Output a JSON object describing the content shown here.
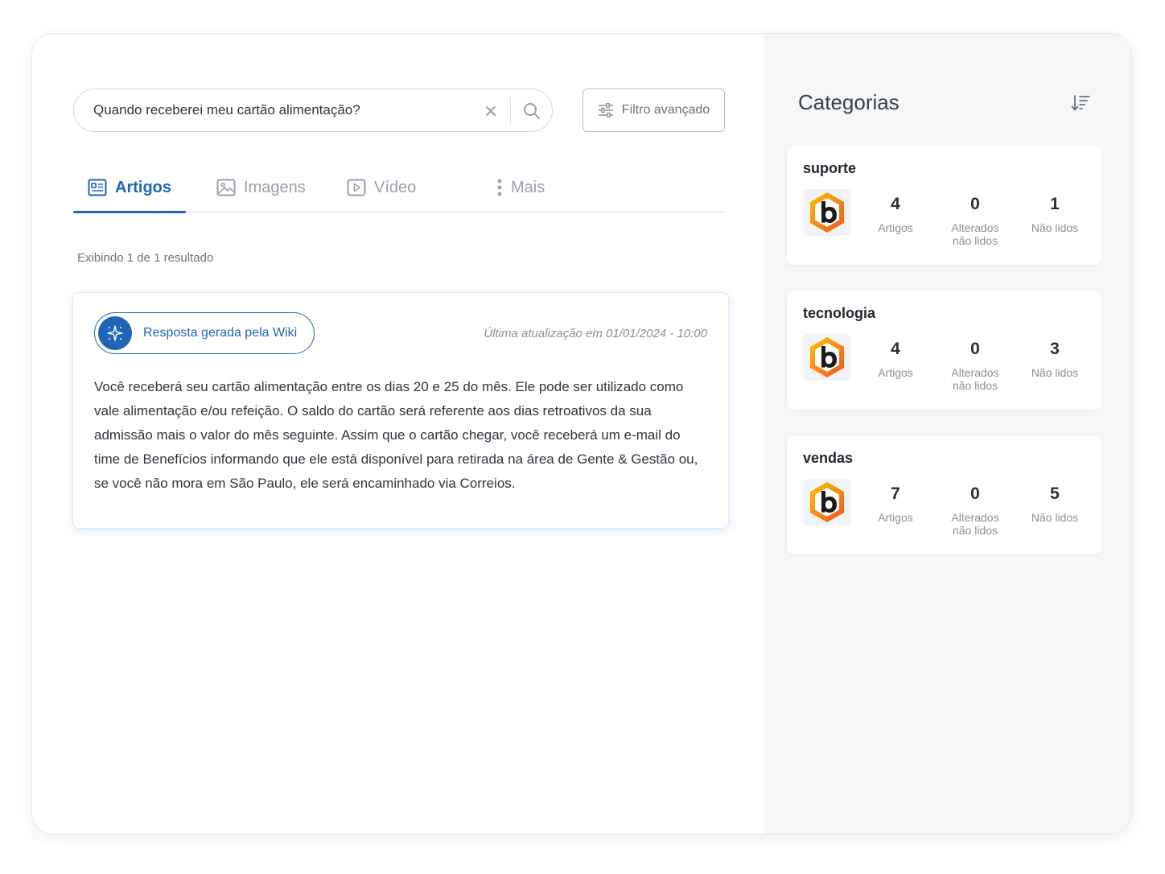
{
  "search": {
    "value": "Quando receberei meu cartão alimentação?",
    "filter_label": "Filtro avançado"
  },
  "tabs": [
    {
      "label": "Artigos",
      "icon": "article-icon",
      "active": true
    },
    {
      "label": "Imagens",
      "icon": "image-icon",
      "active": false
    },
    {
      "label": "Vídeo",
      "icon": "video-icon",
      "active": false
    },
    {
      "label": "Mais",
      "icon": "more-vertical-icon",
      "active": false
    }
  ],
  "results": {
    "count_text": "Exibindo 1 de 1 resultado"
  },
  "answer": {
    "badge_label": "Resposta gerada pela Wiki",
    "updated": "Última atualização em 01/01/2024 - 10:00",
    "text": "Você receberá seu cartão alimentação entre os dias 20 e 25 do mês. Ele pode ser utilizado como vale alimentação e/ou refeição. O saldo do cartão será referente aos dias retroativos da sua admissão mais o valor do mês seguinte. Assim que o cartão chegar, você receberá um e-mail do time de Benefícios informando que ele está disponível para retirada na área de Gente & Gestão ou, se você não mora em São Paulo, ele será encaminhado via Correios."
  },
  "sidebar": {
    "title": "Categorias",
    "categories": [
      {
        "name": "suporte",
        "stats": [
          {
            "value": "4",
            "label": "Artigos"
          },
          {
            "value": "0",
            "label": "Alterados não lidos"
          },
          {
            "value": "1",
            "label": "Não lidos"
          }
        ]
      },
      {
        "name": "tecnologia",
        "stats": [
          {
            "value": "4",
            "label": "Artigos"
          },
          {
            "value": "0",
            "label": "Alterados não lidos"
          },
          {
            "value": "3",
            "label": "Não lidos"
          }
        ]
      },
      {
        "name": "vendas",
        "stats": [
          {
            "value": "7",
            "label": "Artigos"
          },
          {
            "value": "0",
            "label": "Alterados não lidos"
          },
          {
            "value": "5",
            "label": "Não lidos"
          }
        ]
      }
    ]
  },
  "colors": {
    "accent": "#1f66b8",
    "logo_orange": "#f26a21",
    "logo_yellow": "#ffb300"
  }
}
